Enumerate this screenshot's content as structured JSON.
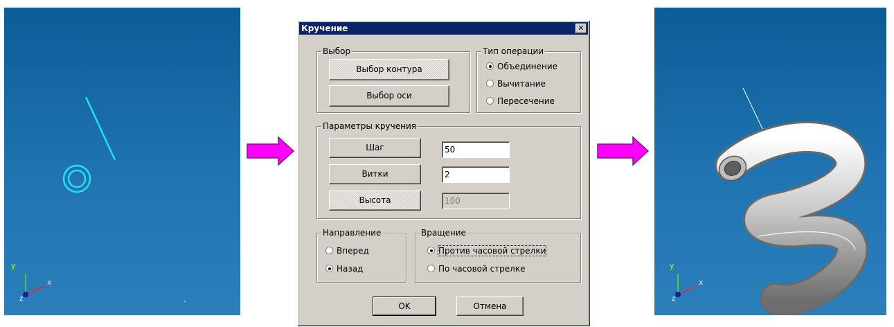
{
  "dialog": {
    "title": "Кручение",
    "close_label": "✕",
    "selection": {
      "label": "Выбор",
      "contour_button": "Выбор контура",
      "axis_button": "Выбор оси"
    },
    "operation_type": {
      "label": "Тип операции",
      "options": [
        "Объединение",
        "Вычитание",
        "Пересечение"
      ],
      "selected": "Объединение"
    },
    "twist_params": {
      "label": "Параметры кручения",
      "step_button": "Шаг",
      "step_value": "50",
      "turns_button": "Витки",
      "turns_value": "2",
      "height_button": "Высота",
      "height_value": "100"
    },
    "direction": {
      "label": "Направление",
      "options": [
        "Вперед",
        "Назад"
      ],
      "selected": "Назад"
    },
    "rotation": {
      "label": "Вращение",
      "options": [
        "Против часовой стрелки",
        "По часовой стрелке"
      ],
      "selected": "Против часовой стрелки"
    },
    "ok_button": "OK",
    "cancel_button": "Отмена"
  },
  "axes": {
    "x_label": "x",
    "y_label": "y",
    "z_label": "z"
  },
  "colors": {
    "arrow_fill": "#ff00ff",
    "viewport_bg": "#1f74b1",
    "curve_color": "#22e0f0",
    "dialog_bg": "#d4d0c8",
    "titlebar_bg": "#0a246a"
  }
}
